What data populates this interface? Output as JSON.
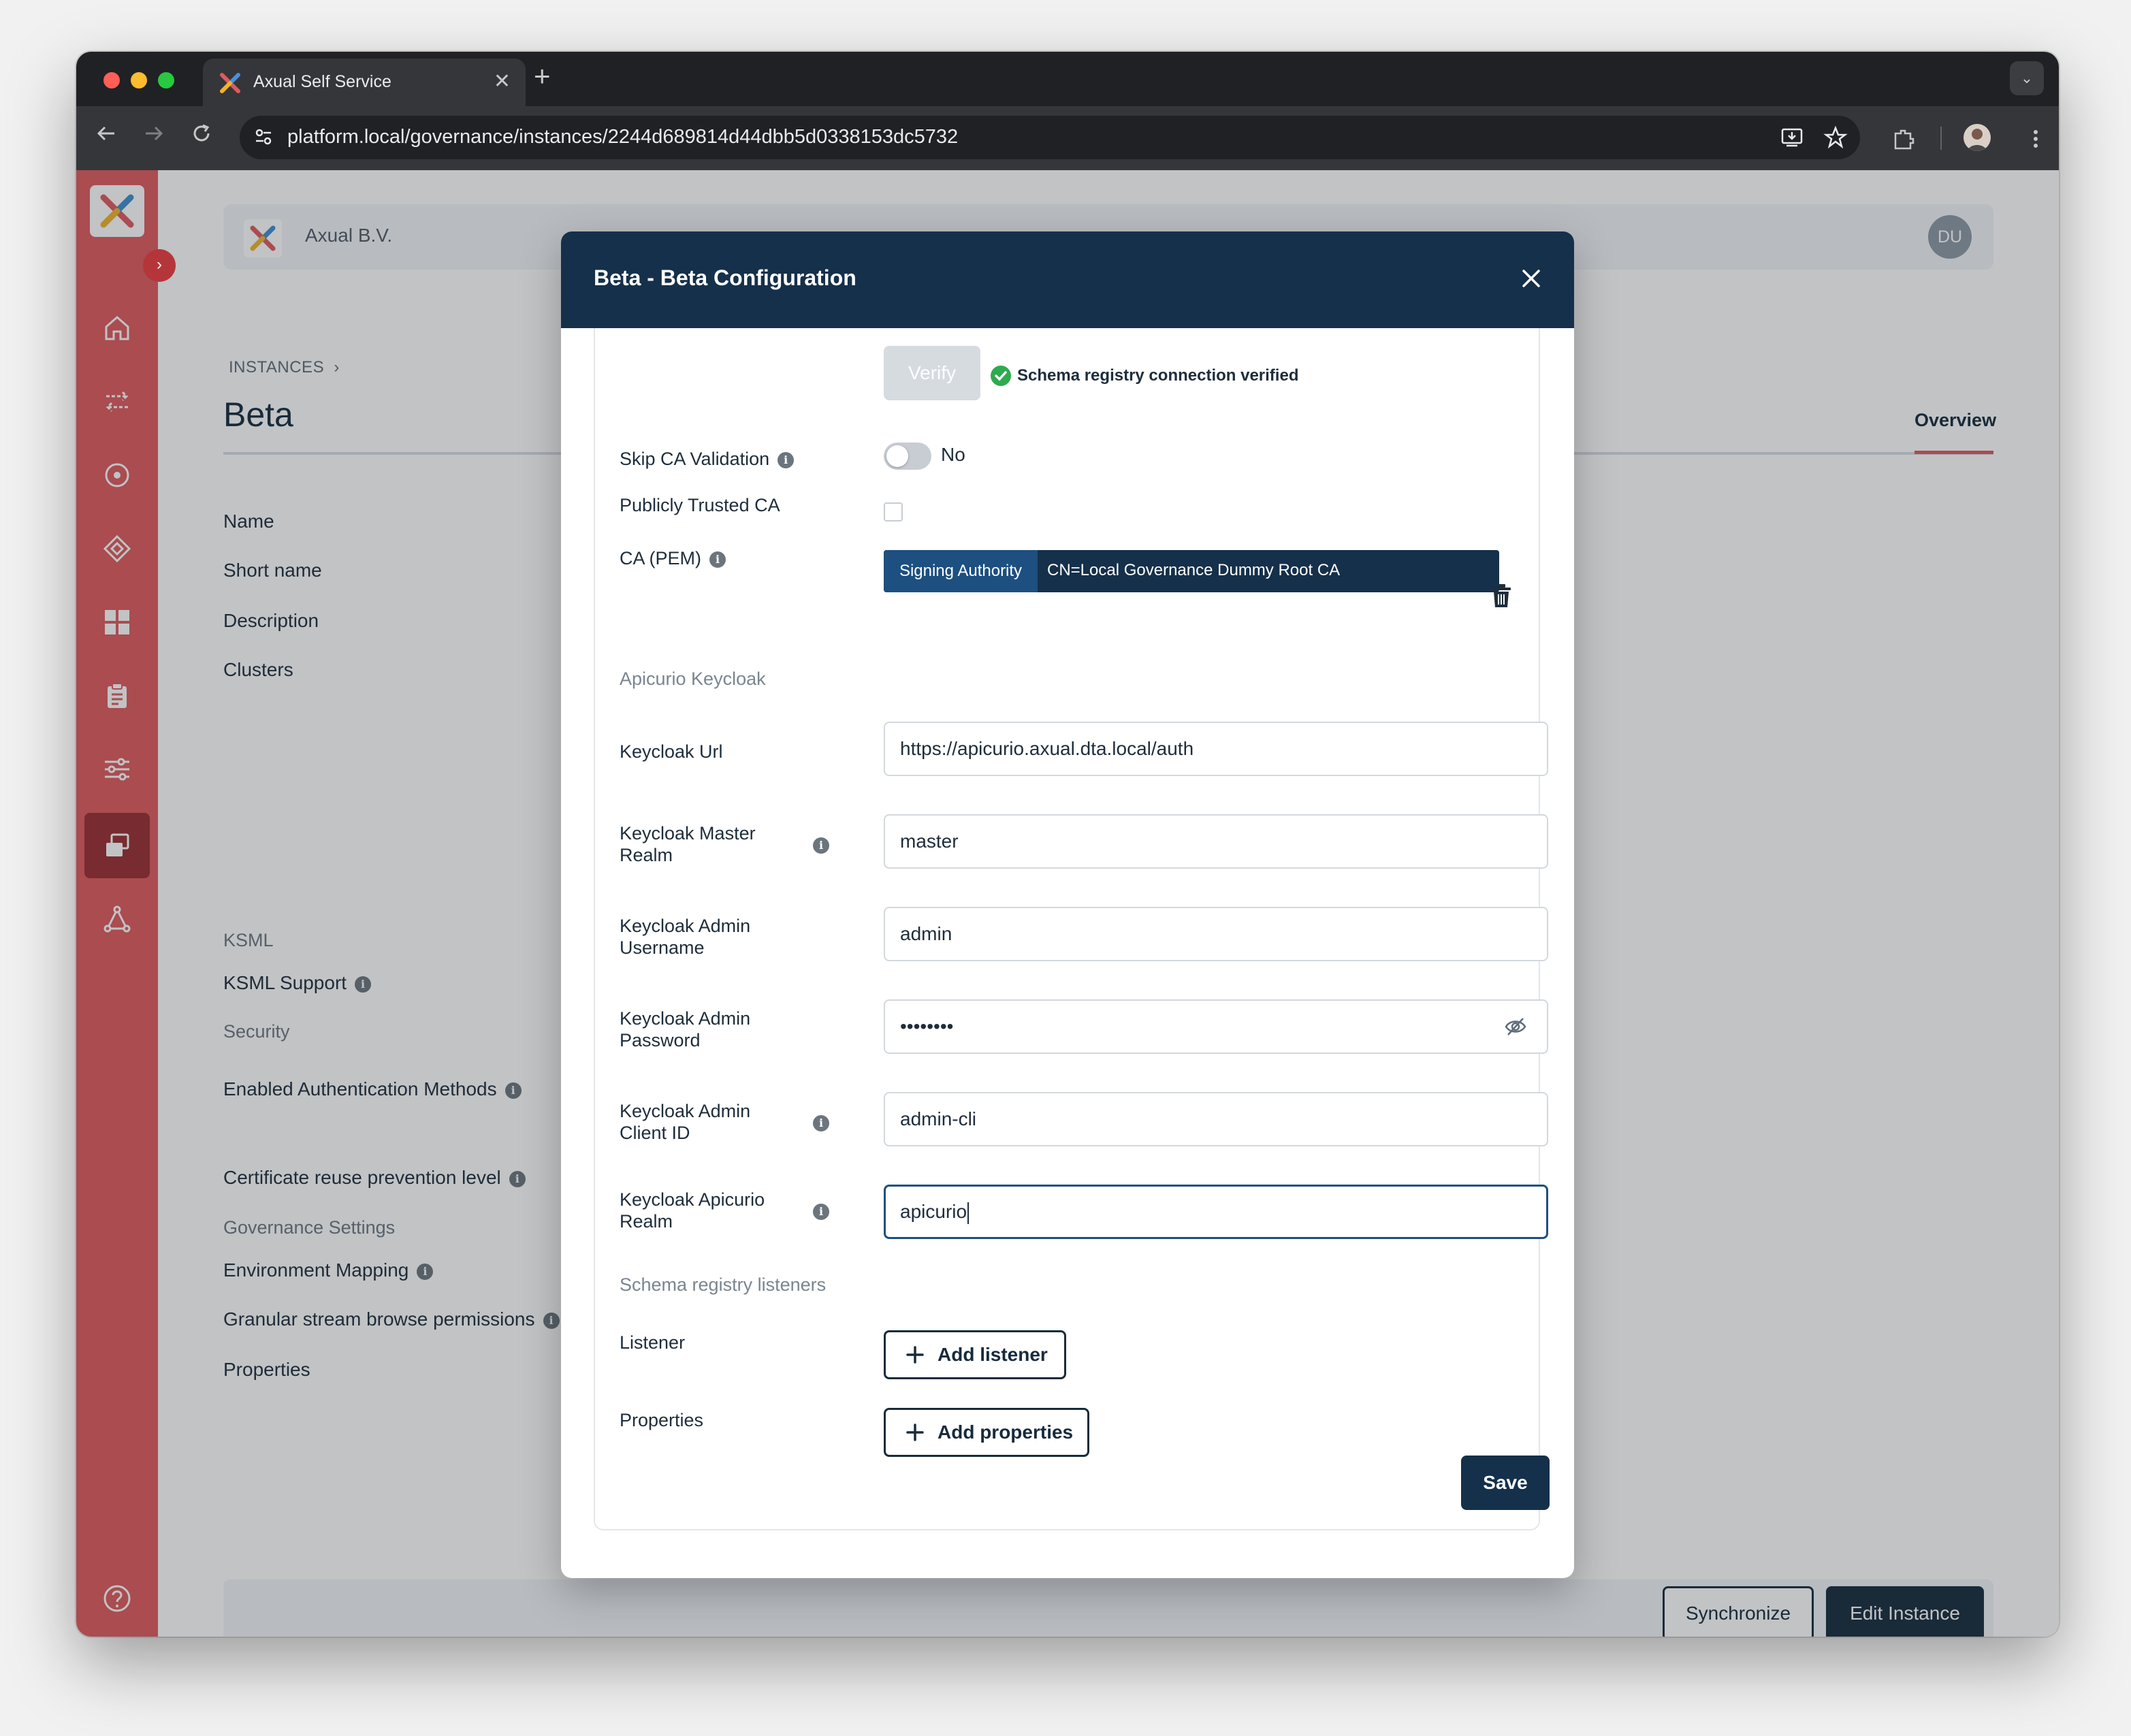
{
  "browser": {
    "tab_title": "Axual Self Service",
    "tab_close": "✕",
    "new_tab": "+",
    "url": "platform.local/governance/instances/2244d689814d44dbb5d0338153dc5732"
  },
  "header": {
    "company": "Axual B.V.",
    "user_initials": "DU"
  },
  "page": {
    "breadcrumb": "INSTANCES",
    "title": "Beta",
    "tab_overview": "Overview",
    "fields": {
      "name": "Name",
      "short_name": "Short name",
      "description": "Description",
      "clusters": "Clusters",
      "ksml_section": "KSML",
      "ksml_support": "KSML Support",
      "security_section": "Security",
      "enabled_auth": "Enabled Authentication Methods",
      "cert_reuse": "Certificate reuse prevention level",
      "governance_section": "Governance Settings",
      "env_mapping": "Environment Mapping",
      "granular": "Granular stream browse permissions",
      "properties": "Properties"
    },
    "buttons": {
      "synchronize": "Synchronize",
      "edit_instance": "Edit Instance"
    }
  },
  "modal": {
    "title": "Beta - Beta Configuration",
    "verify_label": "Verify",
    "verified_text": "Schema registry connection verified",
    "skip_ca_label": "Skip CA Validation",
    "skip_ca_value": "No",
    "public_ca_label": "Publicly Trusted CA",
    "ca_pem_label": "CA (PEM)",
    "ca_tag": "Signing Authority",
    "ca_value": "CN=Local Governance Dummy Root CA",
    "keycloak_section": "Apicurio Keycloak",
    "keycloak_url_label": "Keycloak Url",
    "keycloak_url_value": "https://apicurio.axual.dta.local/auth",
    "master_realm_label_1": "Keycloak Master",
    "master_realm_label_2": "Realm",
    "master_realm_value": "master",
    "admin_user_label_1": "Keycloak Admin",
    "admin_user_label_2": "Username",
    "admin_user_value": "admin",
    "admin_pw_label_1": "Keycloak Admin",
    "admin_pw_label_2": "Password",
    "admin_pw_value": "••••••••",
    "client_id_label_1": "Keycloak Admin",
    "client_id_label_2": "Client ID",
    "client_id_value": "admin-cli",
    "apicurio_realm_label_1": "Keycloak Apicurio",
    "apicurio_realm_label_2": "Realm",
    "apicurio_realm_value": "apicurio",
    "listeners_section": "Schema registry listeners",
    "listener_label": "Listener",
    "add_listener": "Add listener",
    "properties_label": "Properties",
    "add_properties": "Add properties",
    "save": "Save"
  },
  "colors": {
    "sidebar": "#e05a5e",
    "navy": "#15304a",
    "success": "#2eaa4f"
  }
}
